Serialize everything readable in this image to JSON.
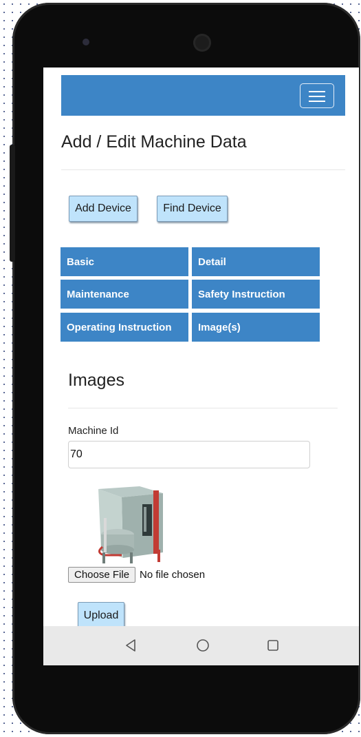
{
  "page": {
    "title": "Add / Edit Machine Data"
  },
  "navbar": {
    "menu_icon": "hamburger-menu-icon",
    "color": "#3d85c6"
  },
  "actions": {
    "add_device": "Add Device",
    "find_device": "Find Device"
  },
  "tabs": [
    {
      "label": "Basic"
    },
    {
      "label": "Detail"
    },
    {
      "label": "Maintenance"
    },
    {
      "label": "Safety Instruction"
    },
    {
      "label": "Operating Instruction"
    },
    {
      "label": "Image(s)"
    }
  ],
  "images_section": {
    "title": "Images",
    "machine_id_label": "Machine Id",
    "machine_id_value": "70",
    "choose_file_label": "Choose File",
    "file_status": "No file chosen",
    "upload_label": "Upload"
  },
  "android_nav": {
    "back_icon": "back-triangle-icon",
    "home_icon": "home-circle-icon",
    "recents_icon": "recents-square-icon"
  },
  "colors": {
    "accent": "#3d85c6",
    "button_bg": "#bfe3fb"
  }
}
